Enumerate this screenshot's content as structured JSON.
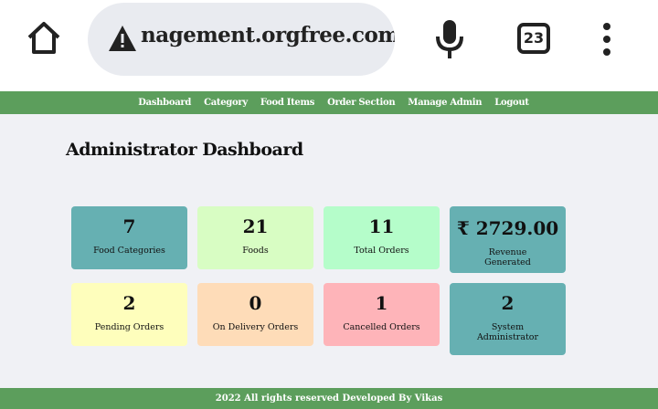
{
  "browser": {
    "url_text": "nagement.orgfree.com",
    "tab_count": "23"
  },
  "nav": {
    "items": [
      "Dashboard",
      "Category",
      "Food Items",
      "Order Section",
      "Manage Admin",
      "Logout"
    ]
  },
  "page_title": "Administrator Dashboard",
  "cards": [
    {
      "value": "7",
      "label": "Food Categories",
      "color": "#66b0b2"
    },
    {
      "value": "21",
      "label": "Foods",
      "color": "#d8fdc3"
    },
    {
      "value": "11",
      "label": "Total Orders",
      "color": "#b5fdca"
    },
    {
      "value": "₹ 2729.00",
      "label": "Revenue Generated",
      "color": "#66b0b2"
    },
    {
      "value": "2",
      "label": "Pending Orders",
      "color": "#fefebc"
    },
    {
      "value": "0",
      "label": "On Delivery Orders",
      "color": "#fedcb8"
    },
    {
      "value": "1",
      "label": "Cancelled Orders",
      "color": "#feb4b9"
    },
    {
      "value": "2",
      "label": "System Administrator",
      "color": "#66b0b2"
    }
  ],
  "footer": "2022 All rights reserved Developed By Vikas"
}
